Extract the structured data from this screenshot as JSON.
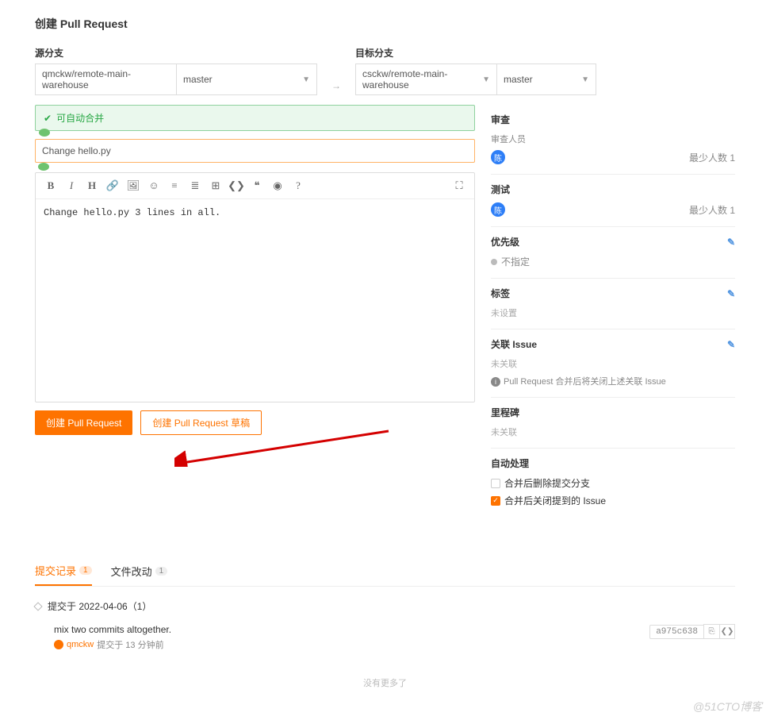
{
  "page_title": "创建 Pull Request",
  "source_branch_label": "源分支",
  "target_branch_label": "目标分支",
  "source_repo": "qmckw/remote-main-warehouse",
  "source_branch": "master",
  "target_repo": "csckw/remote-main-warehouse",
  "target_branch": "master",
  "merge_status": "可自动合并",
  "pr_title": "Change hello.py",
  "pr_body": "Change hello.py 3 lines in all.",
  "btn_create": "创建 Pull Request",
  "btn_draft": "创建 Pull Request 草稿",
  "sidebar": {
    "review": {
      "label": "审查",
      "sub": "审查人员",
      "avatar": "陈",
      "min": "最少人数 1"
    },
    "test": {
      "label": "测试",
      "avatar": "陈",
      "min": "最少人数 1"
    },
    "priority": {
      "label": "优先级",
      "value": "不指定"
    },
    "tags": {
      "label": "标签",
      "value": "未设置"
    },
    "issue": {
      "label": "关联 Issue",
      "value": "未关联",
      "info": "Pull Request 合并后将关闭上述关联 Issue"
    },
    "milestone": {
      "label": "里程碑",
      "value": "未关联"
    },
    "auto": {
      "label": "自动处理",
      "opt1": "合并后删除提交分支",
      "opt2": "合并后关闭提到的 Issue"
    }
  },
  "tabs": {
    "commits": "提交记录",
    "commits_count": "1",
    "files": "文件改动",
    "files_count": "1"
  },
  "commit_group": "提交于 2022-04-06（1）",
  "commit": {
    "message": "mix two commits altogether.",
    "user": "qmckw",
    "time": "提交于 13 分钟前",
    "sha": "a975c638"
  },
  "no_more": "没有更多了",
  "watermark": "@51CTO博客"
}
